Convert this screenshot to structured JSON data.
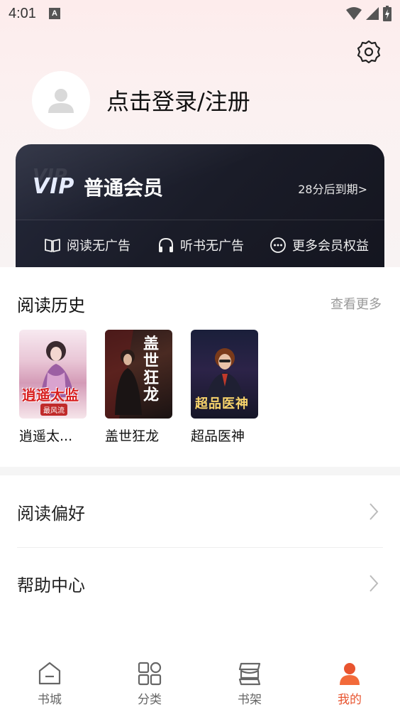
{
  "status_bar": {
    "time": "4:01",
    "notification_letter": "A"
  },
  "profile": {
    "login_text": "点击登录/注册"
  },
  "vip": {
    "logo": "VIP",
    "title": "普通会员",
    "expire_text": "28分后到期>",
    "benefits": [
      {
        "label": "阅读无广告",
        "icon": "book-icon"
      },
      {
        "label": "听书无广告",
        "icon": "headphones-icon"
      },
      {
        "label": "更多会员权益",
        "icon": "more-icon"
      }
    ]
  },
  "history": {
    "title": "阅读历史",
    "see_more": "查看更多",
    "books": [
      {
        "title": "逍遥太...",
        "cover_text": "逍遥太监",
        "cover_sub": "最风流"
      },
      {
        "title": "盖世狂龙",
        "cover_text": "盖世狂龙"
      },
      {
        "title": "超品医神",
        "cover_text": "超品医神"
      }
    ]
  },
  "menu": [
    {
      "label": "阅读偏好"
    },
    {
      "label": "帮助中心"
    }
  ],
  "bottom_nav": [
    {
      "label": "书城",
      "icon": "home-icon"
    },
    {
      "label": "分类",
      "icon": "grid-icon"
    },
    {
      "label": "书架",
      "icon": "bookshelf-icon"
    },
    {
      "label": "我的",
      "icon": "user-icon",
      "active": true
    }
  ],
  "colors": {
    "accent": "#e8542f",
    "vip_bg": "#1c1e2b"
  }
}
